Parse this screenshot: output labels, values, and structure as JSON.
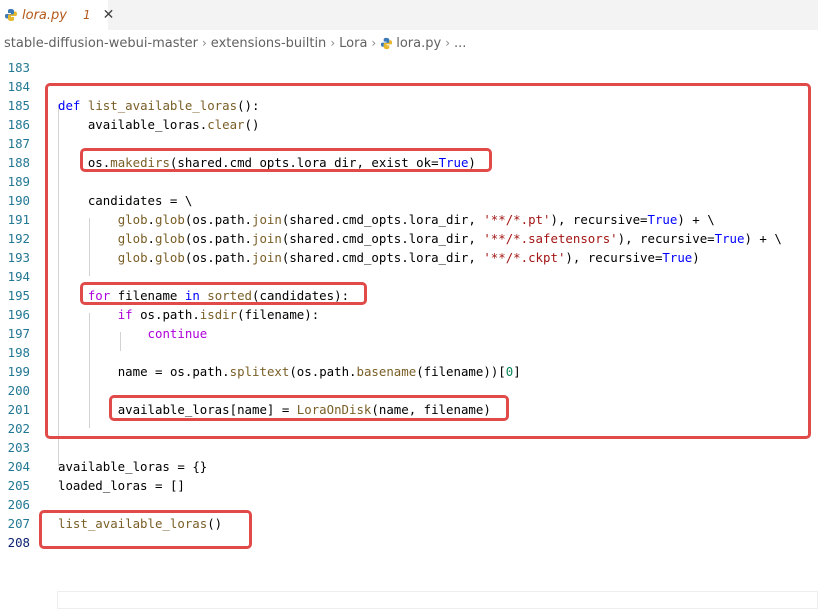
{
  "tab": {
    "name": "lora.py",
    "problem_count": "1",
    "close_glyph": "✕"
  },
  "breadcrumb": {
    "items": [
      "stable-diffusion-webui-master",
      "extensions-builtin",
      "Lora",
      "lora.py",
      "..."
    ],
    "separator": "›"
  },
  "editor": {
    "lines": [
      {
        "n": "183",
        "code": ""
      },
      {
        "n": "184",
        "code": ""
      },
      {
        "n": "185",
        "code": "def list_available_loras():"
      },
      {
        "n": "186",
        "code": "    available_loras.clear()"
      },
      {
        "n": "187",
        "code": ""
      },
      {
        "n": "188",
        "code": "    os.makedirs(shared.cmd_opts.lora_dir, exist_ok=True)"
      },
      {
        "n": "189",
        "code": ""
      },
      {
        "n": "190",
        "code": "    candidates = \\"
      },
      {
        "n": "191",
        "code": "        glob.glob(os.path.join(shared.cmd_opts.lora_dir, '**/*.pt'), recursive=True) + \\"
      },
      {
        "n": "192",
        "code": "        glob.glob(os.path.join(shared.cmd_opts.lora_dir, '**/*.safetensors'), recursive=True) + \\"
      },
      {
        "n": "193",
        "code": "        glob.glob(os.path.join(shared.cmd_opts.lora_dir, '**/*.ckpt'), recursive=True)"
      },
      {
        "n": "194",
        "code": ""
      },
      {
        "n": "195",
        "code": "    for filename in sorted(candidates):"
      },
      {
        "n": "196",
        "code": "        if os.path.isdir(filename):"
      },
      {
        "n": "197",
        "code": "            continue"
      },
      {
        "n": "198",
        "code": ""
      },
      {
        "n": "199",
        "code": "        name = os.path.splitext(os.path.basename(filename))[0]"
      },
      {
        "n": "200",
        "code": ""
      },
      {
        "n": "201",
        "code": "        available_loras[name] = LoraOnDisk(name, filename)"
      },
      {
        "n": "202",
        "code": ""
      },
      {
        "n": "203",
        "code": ""
      },
      {
        "n": "204",
        "code": "available_loras = {}"
      },
      {
        "n": "205",
        "code": "loaded_loras = []"
      },
      {
        "n": "206",
        "code": ""
      },
      {
        "n": "207",
        "code": "list_available_loras()"
      },
      {
        "n": "208",
        "code": ""
      }
    ],
    "active_line": "208"
  },
  "colors": {
    "highlight_box": "#e04a48",
    "line_number": "#237893",
    "keyword": "#0000ff",
    "control_keyword": "#af00db",
    "function": "#795e26",
    "string": "#a31515"
  }
}
